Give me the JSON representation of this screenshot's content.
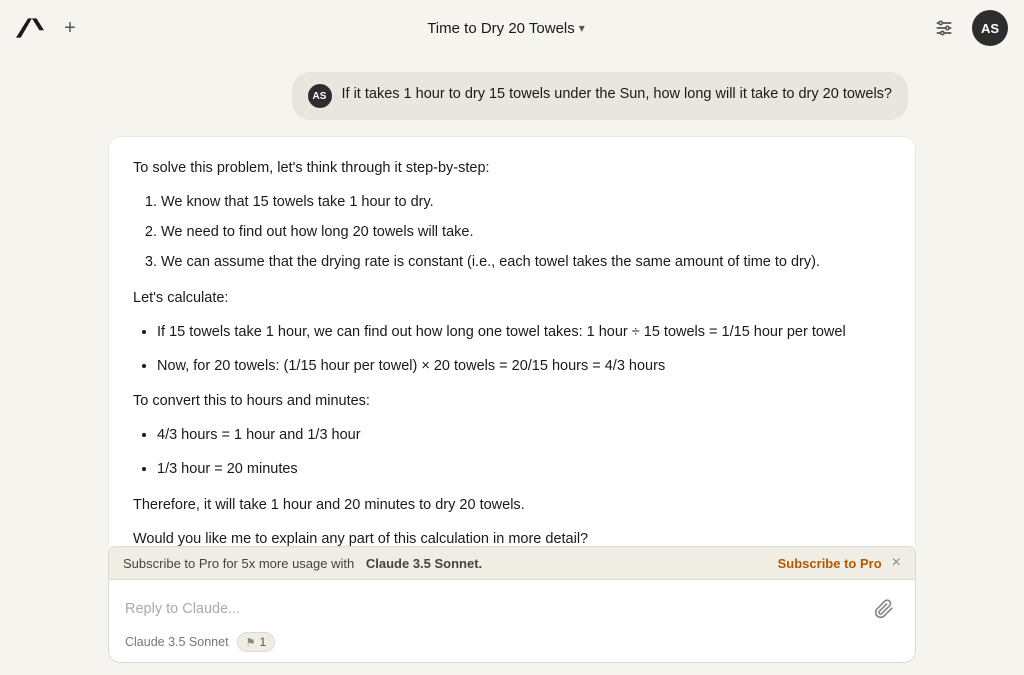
{
  "header": {
    "logo_alt": "Anthropic logo",
    "new_chat_label": "+",
    "title": "Time to Dry 20 Towels",
    "chevron": "▾",
    "settings_icon": "sliders",
    "avatar_initials": "AS"
  },
  "user_message": {
    "avatar_initials": "AS",
    "text": "If it takes 1 hour to dry 15 towels under the Sun, how long will it take to dry 20 towels?"
  },
  "assistant": {
    "intro": "To solve this problem, let's think through it step-by-step:",
    "steps": [
      "We know that 15 towels take 1 hour to dry.",
      "We need to find out how long 20 towels will take.",
      "We can assume that the drying rate is constant (i.e., each towel takes the same amount of time to dry)."
    ],
    "calculate_label": "Let's calculate:",
    "bullets": [
      "If 15 towels take 1 hour, we can find out how long one towel takes: 1 hour ÷ 15 towels = 1/15 hour per towel",
      "Now, for 20 towels: (1/15 hour per towel) × 20 towels = 20/15 hours = 4/3 hours"
    ],
    "convert_label": "To convert this to hours and minutes:",
    "convert_bullets": [
      "4/3 hours = 1 hour and 1/3 hour",
      "1/3 hour = 20 minutes"
    ],
    "conclusion": "Therefore, it will take 1 hour and 20 minutes to dry 20 towels.",
    "follow_up": "Would you like me to explain any part of this calculation in more detail?"
  },
  "subscribe_banner": {
    "text_before": "Subscribe to Pro for 5x more usage with",
    "bold_text": "Claude 3.5 Sonnet.",
    "subscribe_label": "Subscribe to Pro",
    "close_label": "×"
  },
  "input": {
    "placeholder": "Reply to Claude...",
    "attach_icon": "📎",
    "model_label": "Claude 3.5 Sonnet",
    "badge_icon": "⚑",
    "badge_count": "1"
  }
}
